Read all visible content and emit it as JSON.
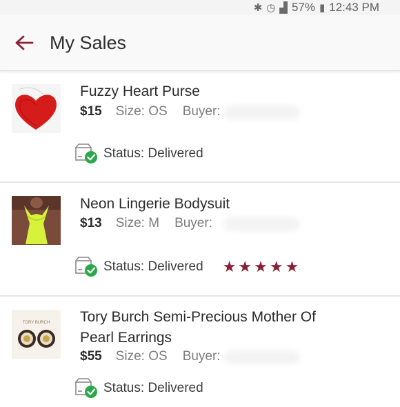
{
  "status_bar": {
    "battery": "57%",
    "time": "12:43 PM"
  },
  "header": {
    "title": "My Sales"
  },
  "accent_color": "#8a1f35",
  "sales": [
    {
      "name": "Fuzzy Heart Purse",
      "price": "$15",
      "size": "Size: OS",
      "buyer_label": "Buyer:",
      "status": "Status: Delivered",
      "rating": null
    },
    {
      "name": "Neon Lingerie Bodysuit",
      "price": "$13",
      "size": "Size: M",
      "buyer_label": "Buyer:",
      "status": "Status: Delivered",
      "rating": 5
    },
    {
      "name_line1": "Tory Burch Semi-Precious Mother Of",
      "name_line2": "Pearl Earrings",
      "price": "$55",
      "size": "Size: OS",
      "buyer_label": "Buyer:",
      "status": "Status: Delivered",
      "rating": null,
      "thumb_text": "TORY BURCH"
    }
  ]
}
